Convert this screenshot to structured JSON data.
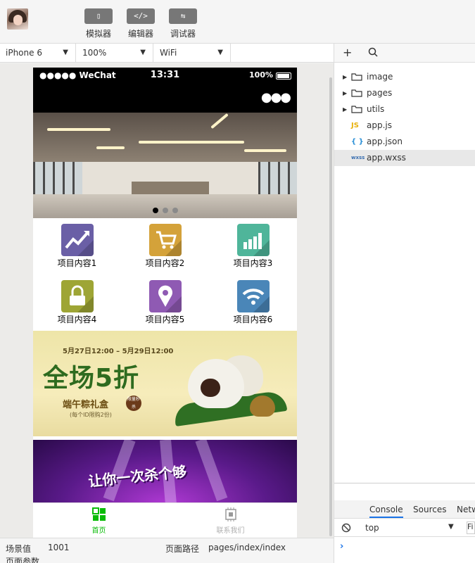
{
  "toolbar": {
    "buttons": [
      {
        "glyph": "▯",
        "label": "模拟器"
      },
      {
        "glyph": "</>",
        "label": "编辑器"
      },
      {
        "glyph": "⇆",
        "label": "调试器"
      }
    ]
  },
  "device": {
    "model": "iPhone 6",
    "zoom": "100%",
    "network": "WiFi"
  },
  "phone": {
    "status": {
      "carrier": "●●●●● WeChat",
      "time": "13:31",
      "battery": "100%"
    },
    "more_glyph": "●●●",
    "carousel": {
      "slides": 3,
      "active_index": 0
    },
    "grid_items": [
      {
        "label": "项目内容1",
        "color": "#6a5fa6",
        "icon": "trend-chart-icon"
      },
      {
        "label": "项目内容2",
        "color": "#d4a23a",
        "icon": "shopping-cart-icon"
      },
      {
        "label": "项目内容3",
        "color": "#4fb59a",
        "icon": "bar-chart-icon"
      },
      {
        "label": "项目内容4",
        "color": "#9ea535",
        "icon": "lock-icon"
      },
      {
        "label": "项目内容5",
        "color": "#8f5ab3",
        "icon": "location-pin-icon"
      },
      {
        "label": "项目内容6",
        "color": "#4a86b8",
        "icon": "wifi-icon"
      }
    ],
    "promo1": {
      "date": "5月27日12:00 – 5月29日12:00",
      "headline": "全场5折",
      "subtitle": "端午粽礼盒",
      "note": "(每个ID限购2份)",
      "badge": "限量秒杀"
    },
    "promo2": {
      "slogan": "让你一次杀个够"
    },
    "tabs": [
      {
        "label": "首页",
        "active": true,
        "color": "#09bb07"
      },
      {
        "label": "联系我们",
        "active": false,
        "color": "#999999"
      }
    ]
  },
  "bottom": {
    "scene_label": "场景值",
    "scene_value": "1001",
    "path_label": "页面路径",
    "path_value": "pages/index/index",
    "params_label": "页面参数"
  },
  "files": [
    {
      "type": "folder",
      "name": "image"
    },
    {
      "type": "folder",
      "name": "pages"
    },
    {
      "type": "folder",
      "name": "utils"
    },
    {
      "type": "js",
      "name": "app.js",
      "badge": "JS",
      "badge_color": "#e8b10c"
    },
    {
      "type": "json",
      "name": "app.json",
      "badge": "{ }",
      "badge_color": "#2a8fd6"
    },
    {
      "type": "wxss",
      "name": "app.wxss",
      "badge": "wxss",
      "badge_color": "#3a6fb0",
      "selected": true
    }
  ],
  "console": {
    "tabs": [
      "Console",
      "Sources",
      "Netw"
    ],
    "context": "top",
    "filter_placeholder": "Fi",
    "prompt": "›"
  }
}
